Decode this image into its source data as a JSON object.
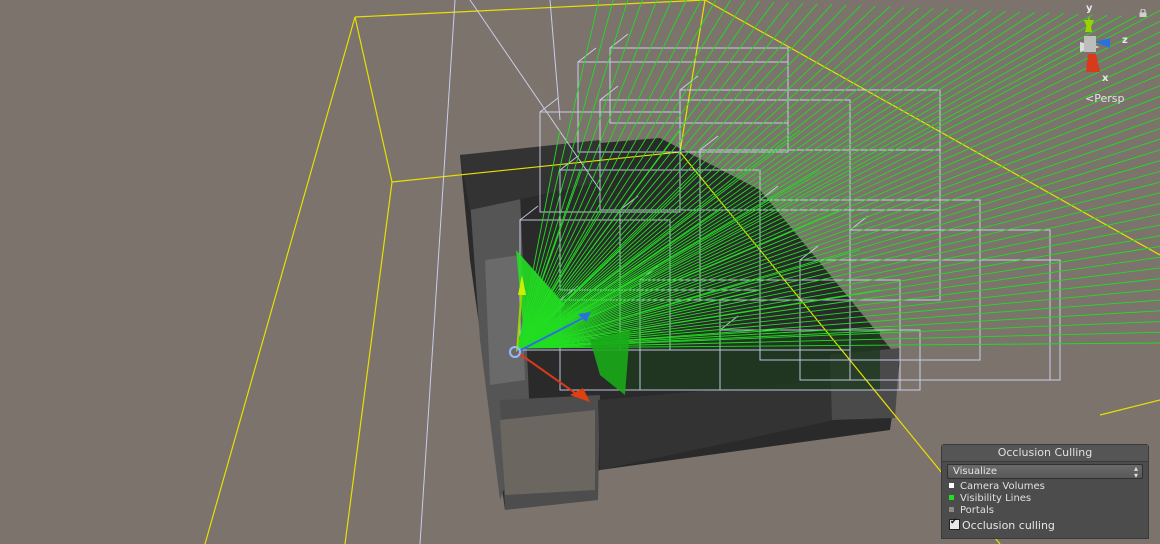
{
  "scene": {
    "projection_label": "Persp",
    "axes": {
      "x": "x",
      "y": "y",
      "z": "z"
    },
    "colors": {
      "background": "#7b736c",
      "bounds_yellow": "#e8e000",
      "visibility_green": "#22dd22",
      "volume_white": "#d8dcff",
      "gizmo_x": "#d83a1a",
      "gizmo_y": "#9ad400",
      "gizmo_z": "#2e6fe0"
    },
    "icons": [
      "lock-icon",
      "scene-gizmo-icon",
      "camera-icon",
      "move-handle-icon"
    ]
  },
  "occlusion_panel": {
    "title": "Occlusion Culling",
    "mode": "Visualize",
    "legend": [
      {
        "label": "Camera Volumes",
        "color": "#ffffff"
      },
      {
        "label": "Visibility Lines",
        "color": "#22dd22"
      },
      {
        "label": "Portals",
        "color": "#8a8a8a"
      }
    ],
    "checkbox_label": "Occlusion culling",
    "checkbox_checked": true
  }
}
